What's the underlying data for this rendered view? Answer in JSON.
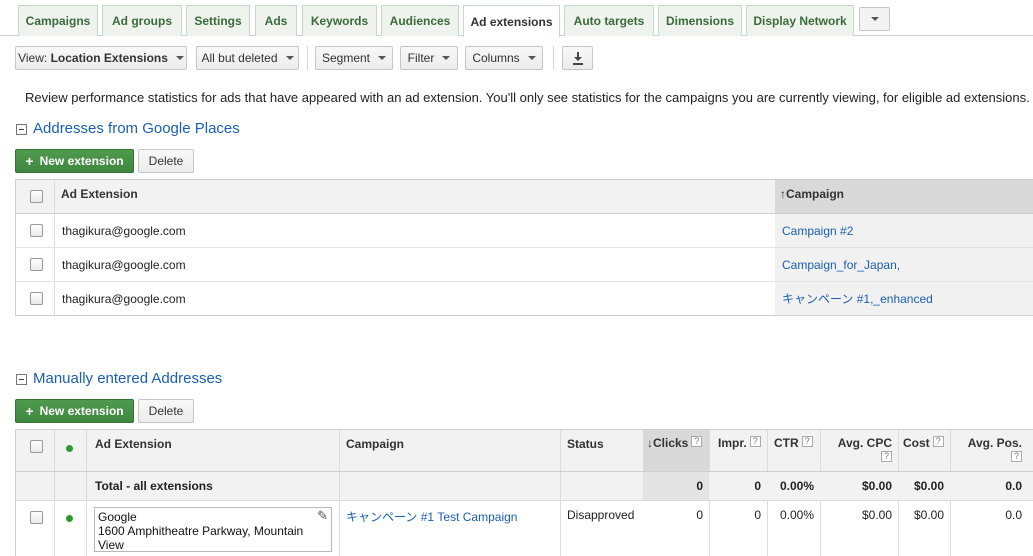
{
  "tabs": [
    {
      "label": "Campaigns"
    },
    {
      "label": "Ad groups"
    },
    {
      "label": "Settings"
    },
    {
      "label": "Ads"
    },
    {
      "label": "Keywords"
    },
    {
      "label": "Audiences"
    },
    {
      "label": "Ad extensions",
      "active": true
    },
    {
      "label": "Auto targets"
    },
    {
      "label": "Dimensions"
    },
    {
      "label": "Display Network"
    }
  ],
  "toolbar": {
    "view_prefix": "View:",
    "view_value": "Location Extensions",
    "filter_status": "All but deleted",
    "segment": "Segment",
    "filter": "Filter",
    "columns": "Columns",
    "download_icon": "download-icon"
  },
  "description": "Review performance statistics for ads that have appeared with an ad extension. You'll only see statistics for the campaigns you are currently viewing, for eligible ad extensions.",
  "places_section": {
    "title": "Addresses from Google Places",
    "new_button": "New extension",
    "delete_button": "Delete",
    "headers": {
      "ad_extension": "Ad Extension",
      "campaign": "Campaign"
    },
    "rows": [
      {
        "ad_extension": "thagikura@google.com",
        "campaign": "Campaign #2"
      },
      {
        "ad_extension": "thagikura@google.com",
        "campaign": "Campaign_for_Japan,"
      },
      {
        "ad_extension": "thagikura@google.com",
        "campaign": "キャンペーン #1,_enhanced"
      }
    ]
  },
  "manual_section": {
    "title": "Manually entered Addresses",
    "new_button": "New extension",
    "delete_button": "Delete",
    "headers": {
      "ad_extension": "Ad Extension",
      "campaign": "Campaign",
      "status": "Status",
      "clicks": "Clicks",
      "impr": "Impr.",
      "ctr": "CTR",
      "avg_cpc": "Avg. CPC",
      "cost": "Cost",
      "avg_pos": "Avg. Pos."
    },
    "total": {
      "label": "Total - all extensions",
      "clicks": "0",
      "impr": "0",
      "ctr": "0.00%",
      "avg_cpc": "$0.00",
      "cost": "$0.00",
      "avg_pos": "0.0"
    },
    "rows": [
      {
        "address_line1": "Google",
        "address_line2": "1600 Amphitheatre Parkway, Mountain View",
        "campaign": "キャンペーン #1 Test Campaign",
        "status": "Disapproved",
        "clicks": "0",
        "impr": "0",
        "ctr": "0.00%",
        "avg_cpc": "$0.00",
        "cost": "$0.00",
        "avg_pos": "0.0"
      }
    ]
  },
  "colors": {
    "accent_green": "#3f873f",
    "link_blue": "#1a5fb4",
    "status_dot": "#2e9a2e"
  }
}
